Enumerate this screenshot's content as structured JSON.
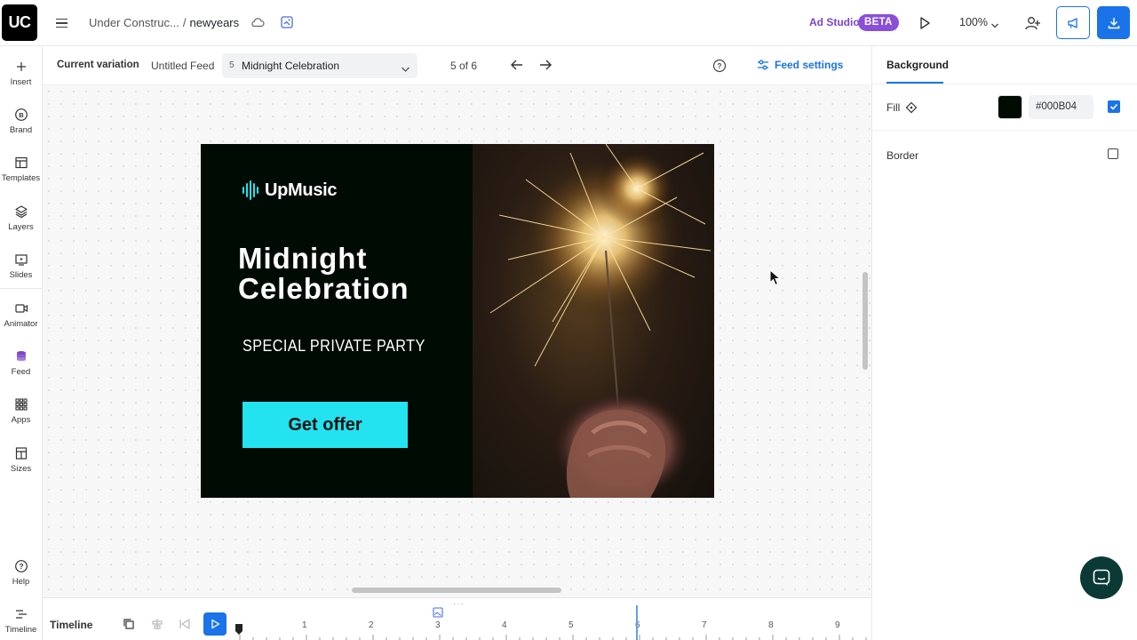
{
  "app": {
    "logo": "UC",
    "breadcrumb_parent": "Under Construc...",
    "breadcrumb_sep": "/",
    "breadcrumb_current": "newyears",
    "ad_studio": "Ad Studio",
    "beta": "BETA",
    "zoom": "100%",
    "accent": "#1a73e8"
  },
  "sidebar": {
    "items": [
      {
        "label": "Insert",
        "icon": "plus-icon"
      },
      {
        "label": "Brand",
        "icon": "brand-icon"
      },
      {
        "label": "Templates",
        "icon": "templates-icon"
      },
      {
        "label": "Layers",
        "icon": "layers-icon"
      },
      {
        "label": "Slides",
        "icon": "slides-icon"
      },
      {
        "label": "Animator",
        "icon": "animator-icon"
      },
      {
        "label": "Feed",
        "icon": "feed-icon"
      },
      {
        "label": "Apps",
        "icon": "apps-icon"
      },
      {
        "label": "Sizes",
        "icon": "sizes-icon"
      }
    ],
    "help": "Help",
    "timeline": "Timeline"
  },
  "variation": {
    "label": "Current variation",
    "feed": "Untitled Feed",
    "selected_index": "5",
    "selected_name": "Midnight Celebration",
    "count": "5 of 6",
    "feed_settings": "Feed settings"
  },
  "banner": {
    "brand": "UpMusic",
    "headline_1": "Midnight",
    "headline_2": "Celebration",
    "subline": "SPECIAL PRIVATE PARTY",
    "cta": "Get offer",
    "background": "#000B04",
    "cta_color": "#22E3EF"
  },
  "panel": {
    "tab": "Background",
    "fill_label": "Fill",
    "fill_hex": "#000B04",
    "fill_enabled": true,
    "border_label": "Border",
    "border_enabled": false
  },
  "timeline": {
    "label": "Timeline",
    "marks": [
      "1",
      "2",
      "3",
      "4",
      "5",
      "6",
      "7",
      "8",
      "9"
    ]
  }
}
